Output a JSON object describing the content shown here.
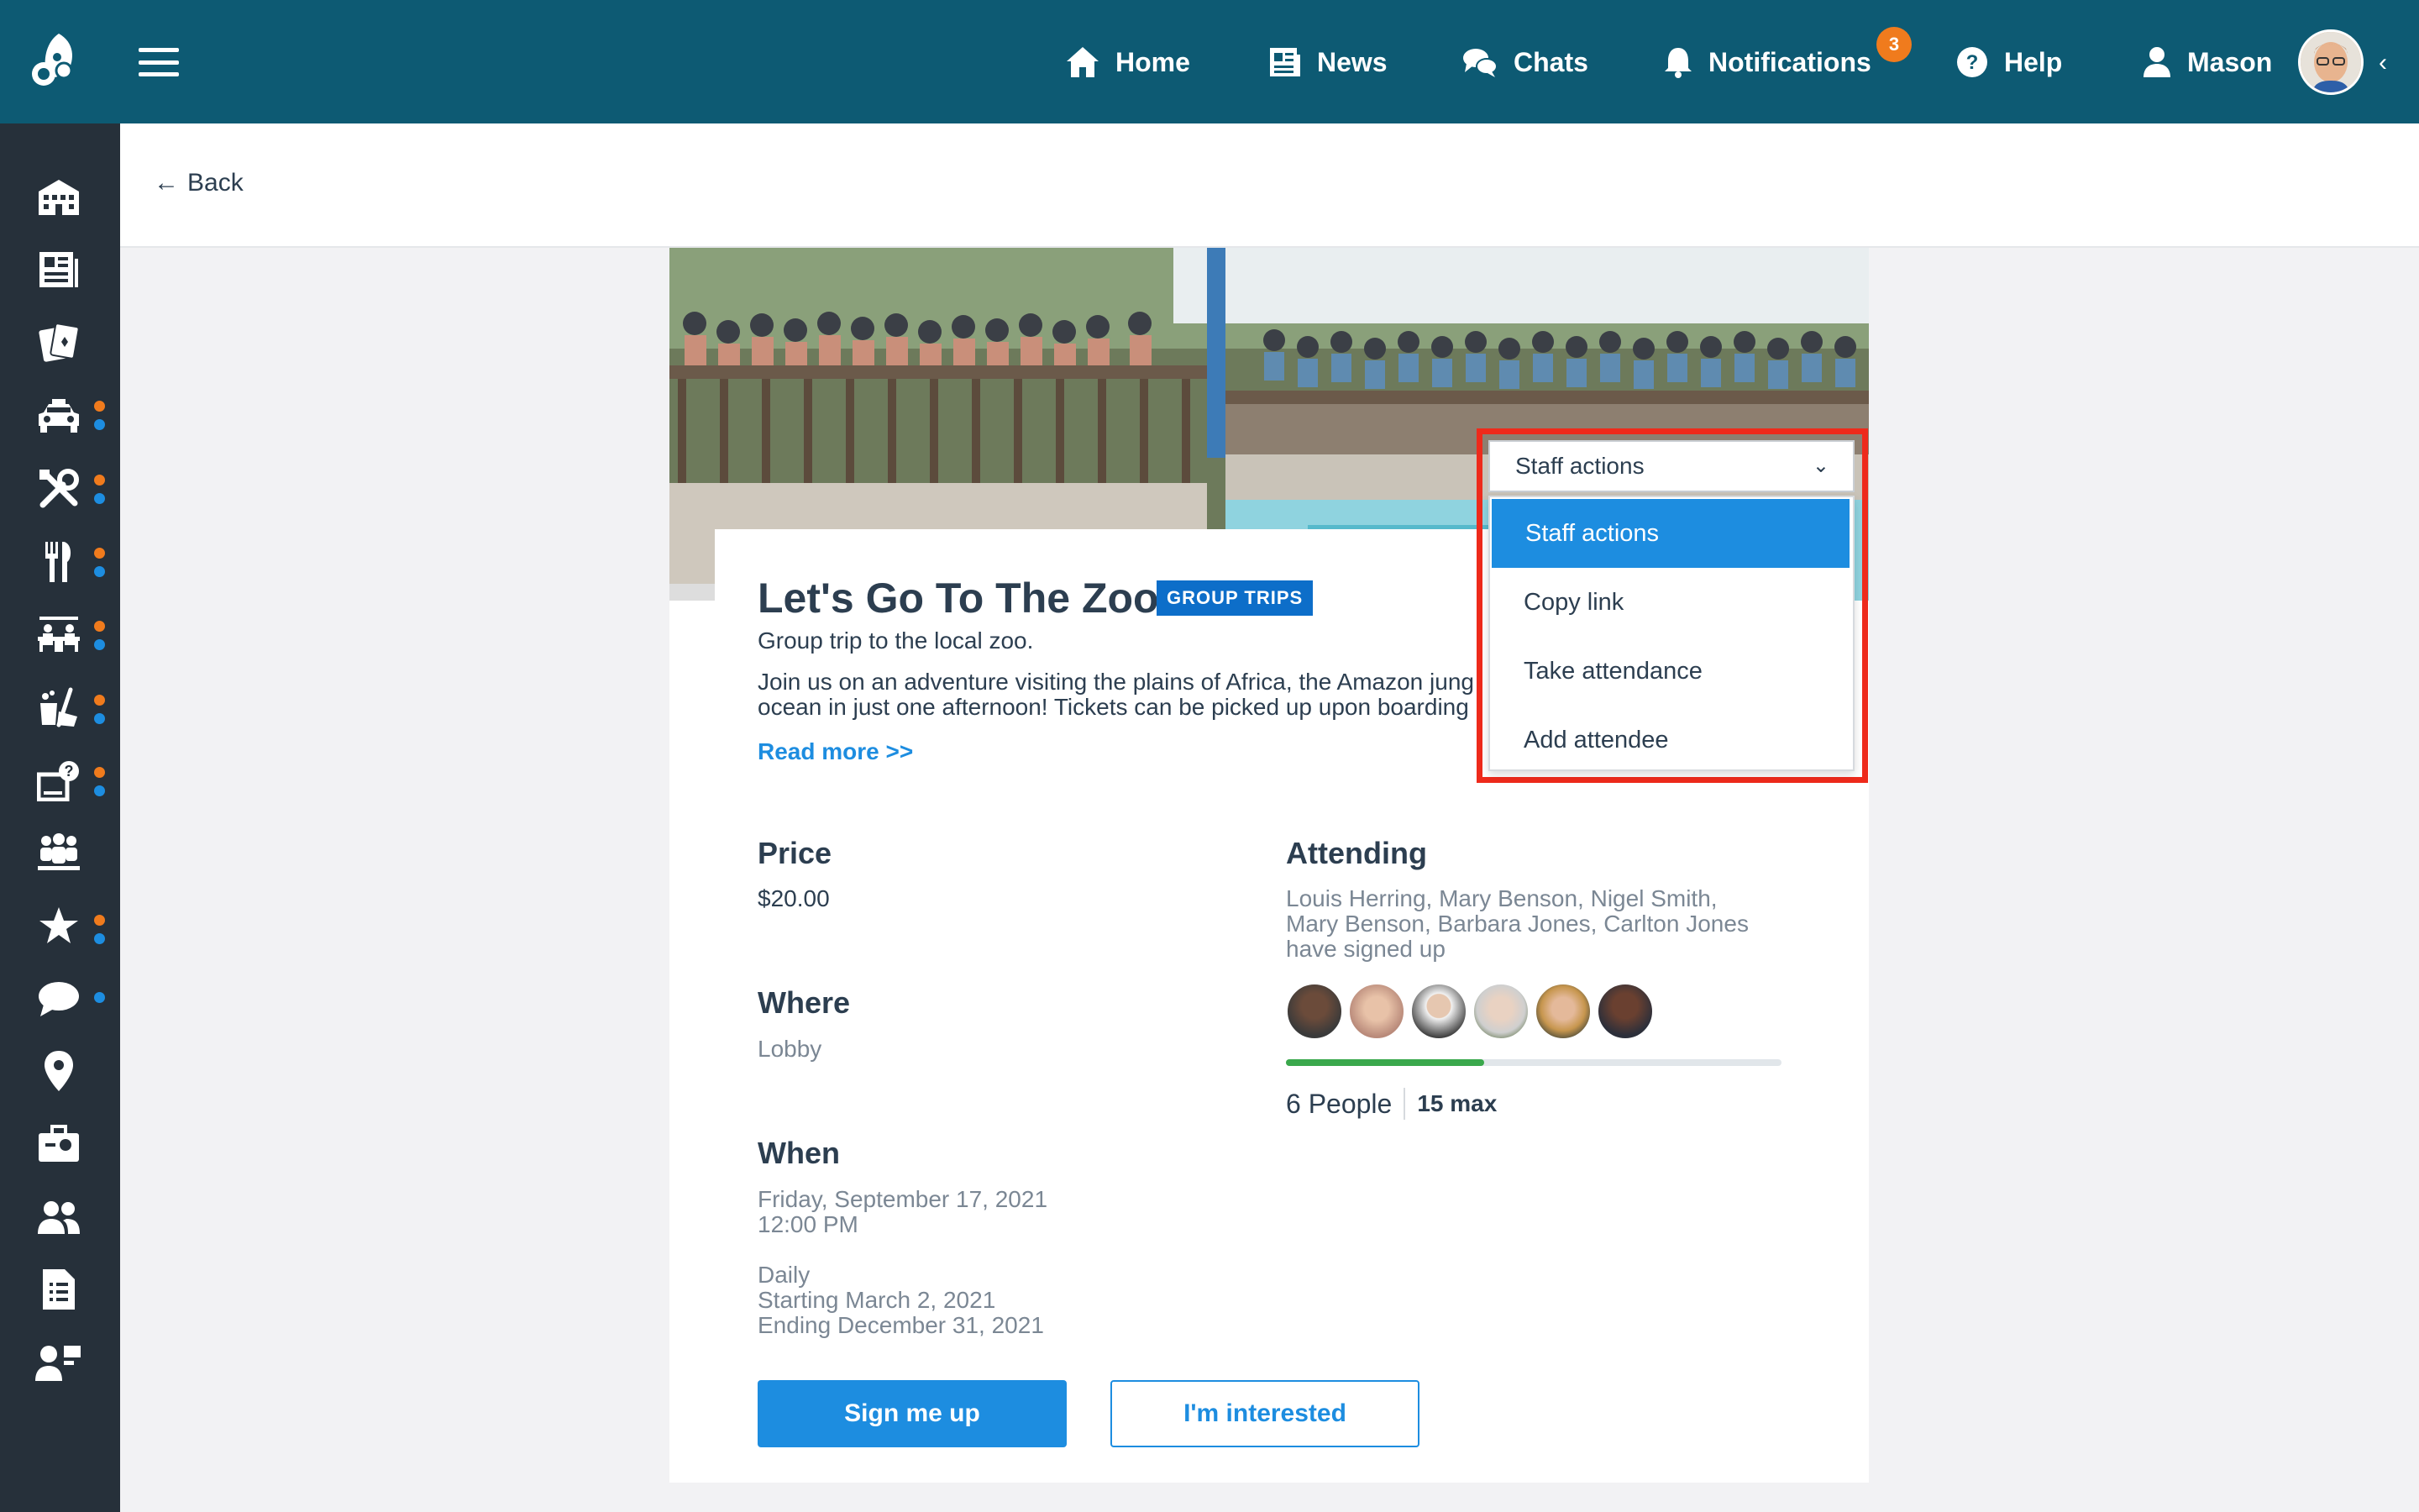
{
  "topbar": {
    "nav": [
      {
        "label": "Home",
        "icon": "home-icon"
      },
      {
        "label": "News",
        "icon": "news-icon"
      },
      {
        "label": "Chats",
        "icon": "chats-icon"
      },
      {
        "label": "Notifications",
        "icon": "bell-icon"
      },
      {
        "label": "Help",
        "icon": "help-icon"
      },
      {
        "label": "Mason",
        "icon": "user-icon"
      }
    ],
    "notifications_count": "3"
  },
  "sidebar": {
    "icons": [
      "building-icon",
      "newspaper-icon",
      "cards-icon",
      "car-icon",
      "tools-icon",
      "dining-icon",
      "classroom-icon",
      "cleaning-icon",
      "support-icon",
      "group-icon",
      "star-icon",
      "chat-bubble-icon",
      "location-pin-icon",
      "briefcase-icon",
      "users-icon",
      "document-icon",
      "profile-flag-icon"
    ]
  },
  "back": {
    "label": "Back"
  },
  "event": {
    "title": "Let's Go To The Zoo!",
    "tag": "GROUP TRIPS",
    "subtitle": "Group trip to the local zoo.",
    "description_line1": "Join us on an adventure visiting the plains of Africa, the Amazon jung",
    "description_line2": "ocean in just one afternoon! Tickets can be picked up upon boarding",
    "read_more": "Read more >>",
    "price_label": "Price",
    "price": "$20.00",
    "where_label": "Where",
    "where": "Lobby",
    "when_label": "When",
    "when_date": "Friday, September 17, 2021",
    "when_time": "12:00 PM",
    "recurrence": "Daily",
    "starting": "Starting March 2, 2021",
    "ending": "Ending December 31, 2021",
    "attending_label": "Attending",
    "attending_line1": "Louis Herring, Mary Benson, Nigel Smith,",
    "attending_line2": "Mary Benson, Barbara Jones, Carlton Jones",
    "attending_line3": "have signed up",
    "people_count": "6 People",
    "max": "15 max",
    "progress_fraction": 0.4,
    "sign_up": "Sign me up",
    "interested": "I'm interested"
  },
  "staff_actions": {
    "selected": "Staff actions",
    "options": [
      "Staff actions",
      "Copy link",
      "Take attendance",
      "Add attendee"
    ]
  },
  "colors": {
    "topbar": "#0d5a73",
    "sidebar": "#26303a",
    "accent": "#1d8de0",
    "highlight": "#ee2a1b",
    "badge": "#f07b1d"
  }
}
